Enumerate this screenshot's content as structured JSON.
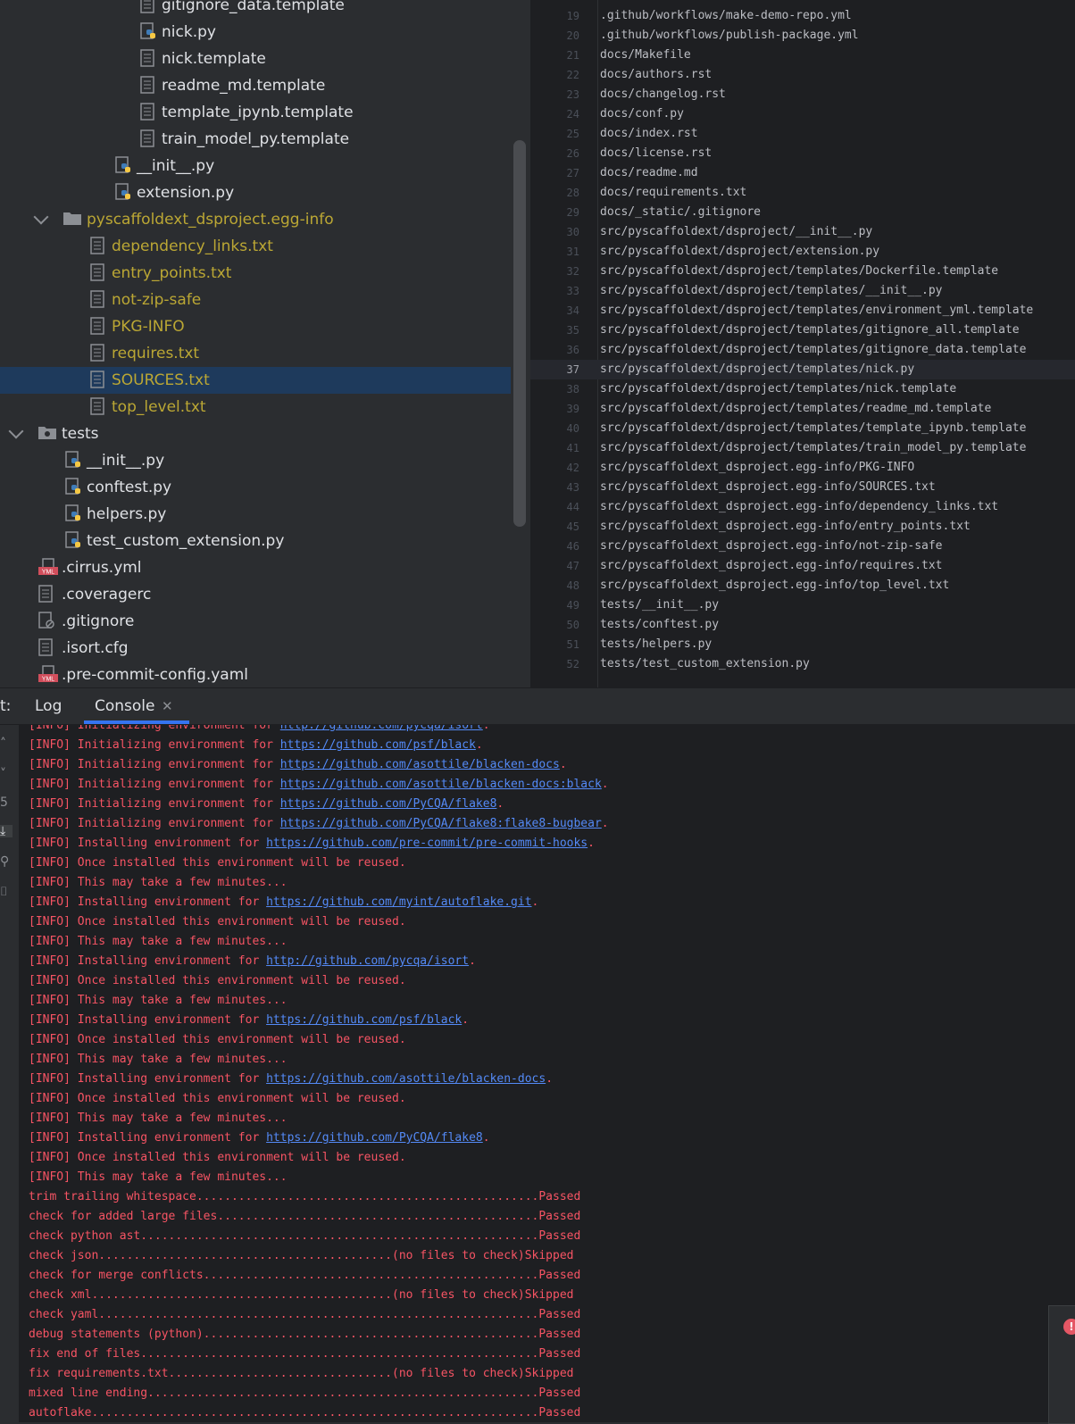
{
  "tree": {
    "rows": [
      {
        "label": "gitignore_data.template",
        "icon": "text-file-icon",
        "level": "file3",
        "vcs": false,
        "sel": false
      },
      {
        "label": "nick.py",
        "icon": "python-file-icon",
        "level": "file3",
        "vcs": false,
        "sel": false
      },
      {
        "label": "nick.template",
        "icon": "text-file-icon",
        "level": "file3",
        "vcs": false,
        "sel": false
      },
      {
        "label": "readme_md.template",
        "icon": "text-file-icon",
        "level": "file3",
        "vcs": false,
        "sel": false
      },
      {
        "label": "template_ipynb.template",
        "icon": "text-file-icon",
        "level": "file3",
        "vcs": false,
        "sel": false
      },
      {
        "label": "train_model_py.template",
        "icon": "text-file-icon",
        "level": "file3",
        "vcs": false,
        "sel": false
      },
      {
        "label": "__init__.py",
        "icon": "python-file-icon",
        "level": "file2",
        "vcs": false,
        "sel": false
      },
      {
        "label": "extension.py",
        "icon": "python-file-icon",
        "level": "file2",
        "vcs": false,
        "sel": false
      },
      {
        "label": "pyscaffoldext_dsproject.egg-info",
        "icon": "folder-icon",
        "level": "dir1",
        "vcs": true,
        "sel": false
      },
      {
        "label": "dependency_links.txt",
        "icon": "text-file-icon",
        "level": "file1",
        "vcs": true,
        "sel": false
      },
      {
        "label": "entry_points.txt",
        "icon": "text-file-icon",
        "level": "file1",
        "vcs": true,
        "sel": false
      },
      {
        "label": "not-zip-safe",
        "icon": "text-file-icon",
        "level": "file1",
        "vcs": true,
        "sel": false
      },
      {
        "label": "PKG-INFO",
        "icon": "text-file-icon",
        "level": "file1",
        "vcs": true,
        "sel": false
      },
      {
        "label": "requires.txt",
        "icon": "text-file-icon",
        "level": "file1",
        "vcs": true,
        "sel": false
      },
      {
        "label": "SOURCES.txt",
        "icon": "text-file-icon",
        "level": "file1",
        "vcs": true,
        "sel": true
      },
      {
        "label": "top_level.txt",
        "icon": "text-file-icon",
        "level": "file1",
        "vcs": true,
        "sel": false
      },
      {
        "label": "tests",
        "icon": "test-folder-icon",
        "level": "dir0",
        "vcs": false,
        "sel": false
      },
      {
        "label": "__init__.py",
        "icon": "python-file-icon",
        "level": "file0",
        "vcs": false,
        "sel": false
      },
      {
        "label": "conftest.py",
        "icon": "python-file-icon",
        "level": "file0",
        "vcs": false,
        "sel": false
      },
      {
        "label": "helpers.py",
        "icon": "python-file-icon",
        "level": "file0",
        "vcs": false,
        "sel": false
      },
      {
        "label": "test_custom_extension.py",
        "icon": "python-file-icon",
        "level": "file0",
        "vcs": false,
        "sel": false
      },
      {
        "label": ".cirrus.yml",
        "icon": "yaml-file-icon",
        "level": "root",
        "vcs": false,
        "sel": false
      },
      {
        "label": ".coveragerc",
        "icon": "text-file-icon",
        "level": "root",
        "vcs": false,
        "sel": false
      },
      {
        "label": ".gitignore",
        "icon": "gitignore-file-icon",
        "level": "root",
        "vcs": false,
        "sel": false
      },
      {
        "label": ".isort.cfg",
        "icon": "text-file-icon",
        "level": "root",
        "vcs": false,
        "sel": false
      },
      {
        "label": ".pre-commit-config.yaml",
        "icon": "yaml-file-icon",
        "level": "root",
        "vcs": false,
        "sel": false
      }
    ]
  },
  "editor": {
    "lines": [
      {
        "n": "19",
        "text": ".github/workflows/make-demo-repo.yml"
      },
      {
        "n": "20",
        "text": ".github/workflows/publish-package.yml"
      },
      {
        "n": "21",
        "text": "docs/Makefile"
      },
      {
        "n": "22",
        "text": "docs/authors.rst"
      },
      {
        "n": "23",
        "text": "docs/changelog.rst"
      },
      {
        "n": "24",
        "text": "docs/conf.py"
      },
      {
        "n": "25",
        "text": "docs/index.rst"
      },
      {
        "n": "26",
        "text": "docs/license.rst"
      },
      {
        "n": "27",
        "text": "docs/readme.md"
      },
      {
        "n": "28",
        "text": "docs/requirements.txt"
      },
      {
        "n": "29",
        "text": "docs/_static/.gitignore"
      },
      {
        "n": "30",
        "text": "src/pyscaffoldext/dsproject/__init__.py"
      },
      {
        "n": "31",
        "text": "src/pyscaffoldext/dsproject/extension.py"
      },
      {
        "n": "32",
        "text": "src/pyscaffoldext/dsproject/templates/Dockerfile.template"
      },
      {
        "n": "33",
        "text": "src/pyscaffoldext/dsproject/templates/__init__.py"
      },
      {
        "n": "34",
        "text": "src/pyscaffoldext/dsproject/templates/environment_yml.template"
      },
      {
        "n": "35",
        "text": "src/pyscaffoldext/dsproject/templates/gitignore_all.template"
      },
      {
        "n": "36",
        "text": "src/pyscaffoldext/dsproject/templates/gitignore_data.template"
      },
      {
        "n": "37",
        "text": "src/pyscaffoldext/dsproject/templates/nick.py",
        "current": true
      },
      {
        "n": "38",
        "text": "src/pyscaffoldext/dsproject/templates/nick.template"
      },
      {
        "n": "39",
        "text": "src/pyscaffoldext/dsproject/templates/readme_md.template"
      },
      {
        "n": "40",
        "text": "src/pyscaffoldext/dsproject/templates/template_ipynb.template"
      },
      {
        "n": "41",
        "text": "src/pyscaffoldext/dsproject/templates/train_model_py.template"
      },
      {
        "n": "42",
        "text": "src/pyscaffoldext_dsproject.egg-info/PKG-INFO"
      },
      {
        "n": "43",
        "text": "src/pyscaffoldext_dsproject.egg-info/SOURCES.txt"
      },
      {
        "n": "44",
        "text": "src/pyscaffoldext_dsproject.egg-info/dependency_links.txt"
      },
      {
        "n": "45",
        "text": "src/pyscaffoldext_dsproject.egg-info/entry_points.txt"
      },
      {
        "n": "46",
        "text": "src/pyscaffoldext_dsproject.egg-info/not-zip-safe"
      },
      {
        "n": "47",
        "text": "src/pyscaffoldext_dsproject.egg-info/requires.txt"
      },
      {
        "n": "48",
        "text": "src/pyscaffoldext_dsproject.egg-info/top_level.txt"
      },
      {
        "n": "49",
        "text": "tests/__init__.py"
      },
      {
        "n": "50",
        "text": "tests/conftest.py"
      },
      {
        "n": "51",
        "text": "tests/helpers.py"
      },
      {
        "n": "52",
        "text": "tests/test_custom_extension.py"
      }
    ]
  },
  "panel": {
    "prefix_label": "t:",
    "tabs": [
      {
        "label": "Log",
        "active": false
      },
      {
        "label": "Console",
        "active": true,
        "close_icon": "close-icon"
      }
    ],
    "console_lines": [
      {
        "pre": "[INFO] Initializing environment for ",
        "link": "http://github.com/pycqa/isort",
        "post": "."
      },
      {
        "pre": "[INFO] Initializing environment for ",
        "link": "https://github.com/psf/black",
        "post": "."
      },
      {
        "pre": "[INFO] Initializing environment for ",
        "link": "https://github.com/asottile/blacken-docs",
        "post": "."
      },
      {
        "pre": "[INFO] Initializing environment for ",
        "link": "https://github.com/asottile/blacken-docs:black",
        "post": "."
      },
      {
        "pre": "[INFO] Initializing environment for ",
        "link": "https://github.com/PyCQA/flake8",
        "post": "."
      },
      {
        "pre": "[INFO] Initializing environment for ",
        "link": "https://github.com/PyCQA/flake8:flake8-bugbear",
        "post": "."
      },
      {
        "pre": "[INFO] Installing environment for ",
        "link": "https://github.com/pre-commit/pre-commit-hooks",
        "post": "."
      },
      {
        "pre": "[INFO] Once installed this environment will be reused."
      },
      {
        "pre": "[INFO] This may take a few minutes..."
      },
      {
        "pre": "[INFO] Installing environment for ",
        "link": "https://github.com/myint/autoflake.git",
        "post": "."
      },
      {
        "pre": "[INFO] Once installed this environment will be reused."
      },
      {
        "pre": "[INFO] This may take a few minutes..."
      },
      {
        "pre": "[INFO] Installing environment for ",
        "link": "http://github.com/pycqa/isort",
        "post": "."
      },
      {
        "pre": "[INFO] Once installed this environment will be reused."
      },
      {
        "pre": "[INFO] This may take a few minutes..."
      },
      {
        "pre": "[INFO] Installing environment for ",
        "link": "https://github.com/psf/black",
        "post": "."
      },
      {
        "pre": "[INFO] Once installed this environment will be reused."
      },
      {
        "pre": "[INFO] This may take a few minutes..."
      },
      {
        "pre": "[INFO] Installing environment for ",
        "link": "https://github.com/asottile/blacken-docs",
        "post": "."
      },
      {
        "pre": "[INFO] Once installed this environment will be reused."
      },
      {
        "pre": "[INFO] This may take a few minutes..."
      },
      {
        "pre": "[INFO] Installing environment for ",
        "link": "https://github.com/PyCQA/flake8",
        "post": "."
      },
      {
        "pre": "[INFO] Once installed this environment will be reused."
      },
      {
        "pre": "[INFO] This may take a few minutes..."
      },
      {
        "pre": "trim trailing whitespace.................................................Passed"
      },
      {
        "pre": "check for added large files..............................................Passed"
      },
      {
        "pre": "check python ast.........................................................Passed"
      },
      {
        "pre": "check json..........................................(no files to check)Skipped"
      },
      {
        "pre": "check for merge conflicts................................................Passed"
      },
      {
        "pre": "check xml...........................................(no files to check)Skipped"
      },
      {
        "pre": "check yaml...............................................................Passed"
      },
      {
        "pre": "debug statements (python)................................................Passed"
      },
      {
        "pre": "fix end of files.........................................................Passed"
      },
      {
        "pre": "fix requirements.txt................................(no files to check)Skipped"
      },
      {
        "pre": "mixed line ending........................................................Passed"
      },
      {
        "pre": "autoflake................................................................Passed"
      }
    ],
    "gutter_icons": [
      "scroll-up-icon",
      "scroll-down-icon",
      "rerun-icon",
      "scroll-to-end-icon",
      "pin-icon",
      "trash-icon"
    ],
    "notification": {
      "icon": "error-icon",
      "text": "!"
    }
  },
  "colors": {
    "vcs_unversioned": "#bba734",
    "selection": "#1e3a5c",
    "console_error": "#f75464",
    "link": "#548af7",
    "tab_underline": "#3574f0"
  }
}
